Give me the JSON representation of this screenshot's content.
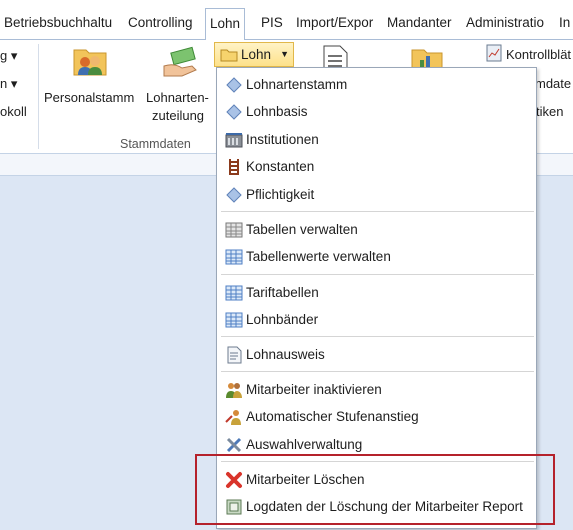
{
  "tabs": [
    {
      "label": "Betriebsbuchhaltu",
      "active": false
    },
    {
      "label": "Controlling",
      "active": false
    },
    {
      "label": "Lohn",
      "active": true
    },
    {
      "label": "PIS",
      "active": false
    },
    {
      "label": "Import/Expor",
      "active": false
    },
    {
      "label": "Mandanter",
      "active": false
    },
    {
      "label": "Administratio",
      "active": false
    },
    {
      "label": "In",
      "active": false
    }
  ],
  "ribbon": {
    "left_partial": {
      "line1": "g ▾",
      "line2": "n ▾",
      "line3": "okoll"
    },
    "personalstamm": "Personalstamm",
    "lohnartenzuteilung_l1": "Lohnarten-",
    "lohnartenzuteilung_l2": "zuteilung",
    "stammdaten_group": "Stammdaten",
    "lohn_button": "Lohn",
    "right": {
      "kontrollblaetter": "Kontrollblät",
      "mdate": "mdate",
      "tiken": "tiken"
    }
  },
  "menu": {
    "items": [
      {
        "label": "Lohnartenstamm",
        "icon": "blue-diamond-icon"
      },
      {
        "label": "Lohnbasis",
        "icon": "blue-diamond-icon"
      },
      {
        "label": "Institutionen",
        "icon": "institution-building-icon"
      },
      {
        "label": "Konstanten",
        "icon": "ladder-icon"
      },
      {
        "label": "Pflichtigkeit",
        "icon": "blue-diamond-icon"
      },
      {
        "label": "Tabellen verwalten",
        "icon": "table-gray-icon"
      },
      {
        "label": "Tabellenwerte verwalten",
        "icon": "table-blue-icon"
      },
      {
        "label": "Tariftabellen",
        "icon": "table-blue-icon"
      },
      {
        "label": "Lohnbänder",
        "icon": "table-blue-icon"
      },
      {
        "label": "Lohnausweis",
        "icon": "document-icon"
      },
      {
        "label": "Mitarbeiter inaktivieren",
        "icon": "users-icon"
      },
      {
        "label": "Automatischer Stufenanstieg",
        "icon": "user-arrow-icon"
      },
      {
        "label": "Auswahlverwaltung",
        "icon": "tools-icon"
      },
      {
        "label": "Mitarbeiter Löschen",
        "icon": "red-x-icon"
      },
      {
        "label": "Logdaten der Löschung der Mitarbeiter Report",
        "icon": "report-icon"
      }
    ]
  },
  "colors": {
    "highlight_border": "#b5222b",
    "background": "#dce6f4",
    "lohn_button": "#fde18a"
  }
}
